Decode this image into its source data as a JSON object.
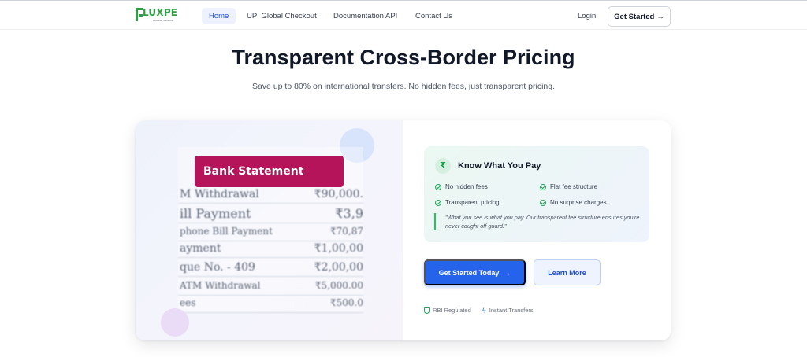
{
  "brand": {
    "name": "LUXPE",
    "tagline": "Financial Solutions",
    "color": "#2f9e44"
  },
  "nav": {
    "links": [
      {
        "label": "Home",
        "active": true
      },
      {
        "label": "UPI Global Checkout",
        "active": false
      },
      {
        "label": "Documentation API",
        "active": false
      },
      {
        "label": "Contact Us",
        "active": false
      }
    ],
    "login_label": "Login",
    "get_started_label": "Get Started",
    "get_started_icon": "arrow-right-icon"
  },
  "hero": {
    "title": "Transparent Cross-Border Pricing",
    "subtitle": "Save up to 80% on international transfers. No hidden fees, just transparent pricing."
  },
  "statement": {
    "header": "Bank Statement",
    "rows": [
      {
        "label": "M Withdrawal",
        "amount": "₹90,000."
      },
      {
        "label": "ill Payment",
        "amount": "₹3,9"
      },
      {
        "label": "phone Bill Payment",
        "amount": "₹70,87"
      },
      {
        "label": "ayment",
        "amount": "₹1,00,00"
      },
      {
        "label": "que No. - 409",
        "amount": "₹2,00,00"
      },
      {
        "label": "ATM Withdrawal",
        "amount": "₹5,000.00"
      },
      {
        "label": "ees",
        "amount": "₹500.0"
      }
    ]
  },
  "pricing": {
    "icon": "rupee-icon",
    "icon_glyph": "₹",
    "title": "Know What You Pay",
    "features": [
      "No hidden fees",
      "Flat fee structure",
      "Transparent pricing",
      "No surprise charges"
    ],
    "quote": "\"What you see is what you pay. Our transparent fee structure ensures you're never caught off guard.\""
  },
  "actions": {
    "primary_label": "Get Started Today",
    "primary_icon": "arrow-right-icon",
    "secondary_label": "Learn More"
  },
  "badges": [
    {
      "icon": "shield-check-icon",
      "label": "RBI Regulated"
    },
    {
      "icon": "lightning-icon",
      "label": "Instant Transfers"
    }
  ],
  "colors": {
    "accent": "#2563eb",
    "success": "#22a55b",
    "statement_header": "#b5145a"
  }
}
